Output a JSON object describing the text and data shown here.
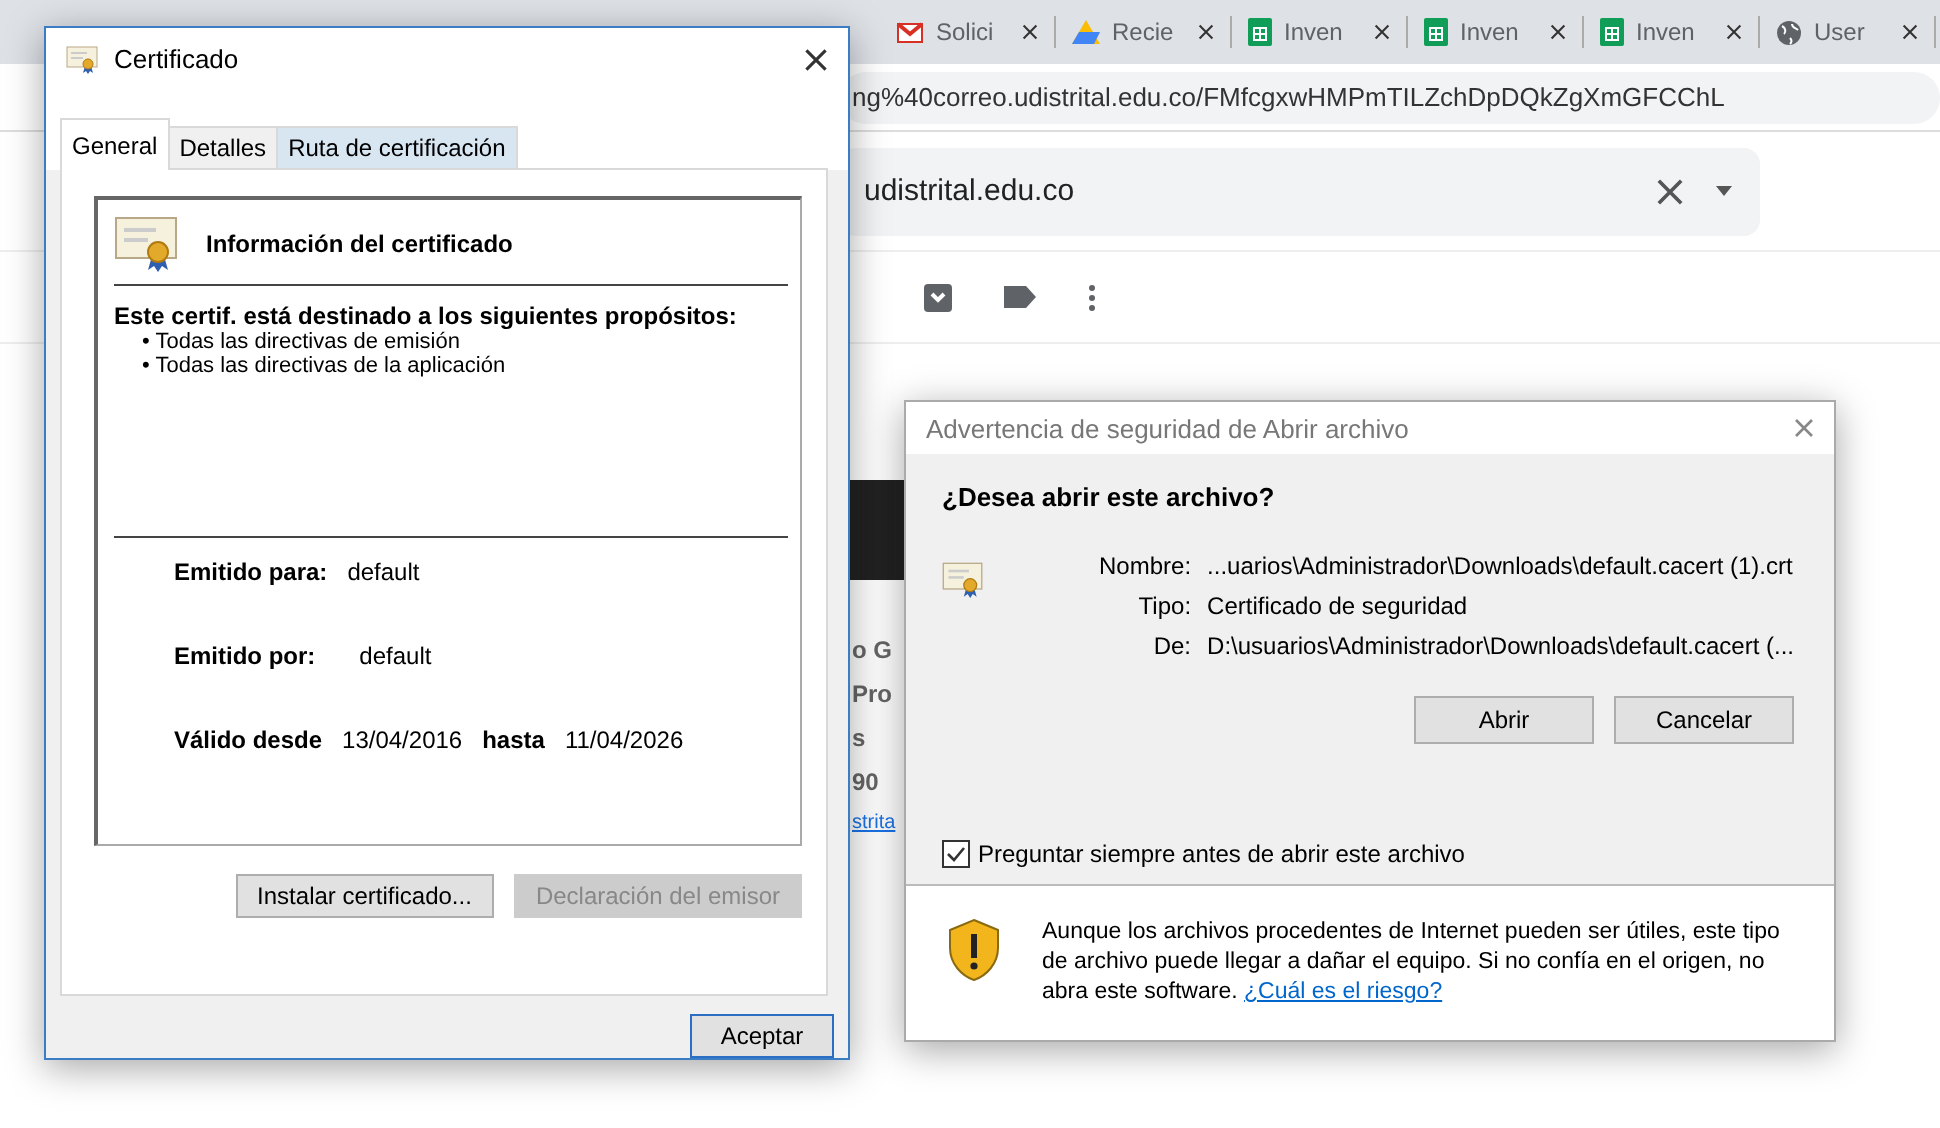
{
  "browser": {
    "tabs": [
      {
        "label": "Solici",
        "kind": "mail"
      },
      {
        "label": "Recie",
        "kind": "drive"
      },
      {
        "label": "Inven",
        "kind": "sheets"
      },
      {
        "label": "Inven",
        "kind": "sheets"
      },
      {
        "label": "Inven",
        "kind": "sheets"
      },
      {
        "label": "User",
        "kind": "web"
      }
    ],
    "address": "ng%40correo.udistrital.edu.co/FMfcgxwHMPmTILZchDpDQkZgXmGFCChL",
    "search": {
      "value": "udistrital.edu.co"
    },
    "page_fragments": [
      "o G",
      "Pro",
      "s",
      "90"
    ],
    "page_link": "strita"
  },
  "certificate_dialog": {
    "title": "Certificado",
    "tabs": [
      {
        "label": "General",
        "selected": true,
        "hovered": false
      },
      {
        "label": "Detalles",
        "selected": false,
        "hovered": false
      },
      {
        "label": "Ruta de certificación",
        "selected": false,
        "hovered": true
      }
    ],
    "heading": "Información del certificado",
    "purposes_title": "Este certif. está destinado a los siguientes propósitos:",
    "purposes": [
      "• Todas las directivas de emisión",
      "• Todas las directivas de la aplicación"
    ],
    "issued_to": {
      "label": "Emitido para:",
      "value": "default"
    },
    "issued_by": {
      "label": "Emitido por:",
      "value": "default"
    },
    "validity": {
      "from_label": "Válido desde",
      "from": "13/04/2016",
      "to_label": "hasta",
      "to": "11/04/2026"
    },
    "buttons": [
      {
        "label": "Instalar certificado...",
        "disabled": false
      },
      {
        "label": "Declaración del emisor",
        "disabled": true
      }
    ],
    "ok_button": "Aceptar"
  },
  "security_dialog": {
    "title": "Advertencia de seguridad de Abrir archivo",
    "question": "¿Desea abrir este archivo?",
    "fields": [
      {
        "label": "Nombre:",
        "value": "...uarios\\Administrador\\Downloads\\default.cacert (1).crt"
      },
      {
        "label": "Tipo:",
        "value": "Certificado de seguridad"
      },
      {
        "label": "De:",
        "value": "D:\\usuarios\\Administrador\\Downloads\\default.cacert (..."
      }
    ],
    "buttons": [
      "Abrir",
      "Cancelar"
    ],
    "checkbox": {
      "label": "Preguntar siempre antes de abrir este archivo",
      "checked": true
    },
    "warning": "Aunque los archivos procedentes de Internet pueden ser útiles, este tipo de archivo puede llegar a dañar el equipo. Si no confía en el origen, no abra este software.",
    "warning_link": "¿Cuál es el riesgo?"
  }
}
